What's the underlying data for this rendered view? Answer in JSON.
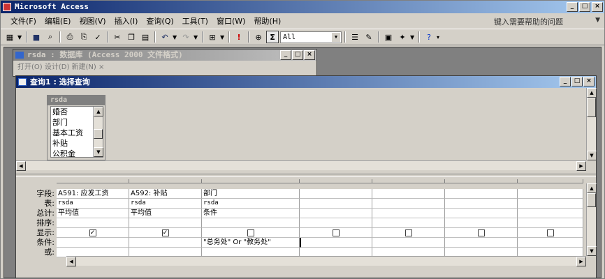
{
  "app": {
    "title": "Microsoft Access"
  },
  "menubar": {
    "items": [
      "文件(F)",
      "编辑(E)",
      "视图(V)",
      "插入(I)",
      "查询(Q)",
      "工具(T)",
      "窗口(W)",
      "帮助(H)"
    ],
    "help_text": "键入需要帮助的问题"
  },
  "toolbar": {
    "combo_value": "All"
  },
  "db_window": {
    "title": "rsda : 数据库 (Access 2000 文件格式)",
    "toolbar_text": "打开(O) 设计(D) 新建(N) ×"
  },
  "query_window": {
    "title": "查询1 : 选择查询",
    "table": {
      "name": "rsda",
      "fields": [
        "婚否",
        "部门",
        "基本工资",
        "补贴",
        "公积金"
      ]
    },
    "row_labels": [
      "字段:",
      "表:",
      "总计:",
      "排序:",
      "显示:",
      "条件:",
      "或:"
    ],
    "columns": [
      {
        "field": "A591: 应发工资",
        "table": "rsda",
        "total": "平均值",
        "sort": "",
        "show": true,
        "criteria": "",
        "or": ""
      },
      {
        "field": "A592: 补贴",
        "table": "rsda",
        "total": "平均值",
        "sort": "",
        "show": true,
        "criteria": "",
        "or": ""
      },
      {
        "field": "部门",
        "table": "rsda",
        "total": "条件",
        "sort": "",
        "show": false,
        "criteria": "\"总务处\" Or \"教务处\"",
        "or": ""
      },
      {
        "field": "",
        "table": "",
        "total": "",
        "sort": "",
        "show": false,
        "criteria": "",
        "or": ""
      },
      {
        "field": "",
        "table": "",
        "total": "",
        "sort": "",
        "show": false,
        "criteria": "",
        "or": ""
      },
      {
        "field": "",
        "table": "",
        "total": "",
        "sort": "",
        "show": false,
        "criteria": "",
        "or": ""
      },
      {
        "field": "",
        "table": "",
        "total": "",
        "sort": "",
        "show": false,
        "criteria": "",
        "or": ""
      }
    ]
  }
}
